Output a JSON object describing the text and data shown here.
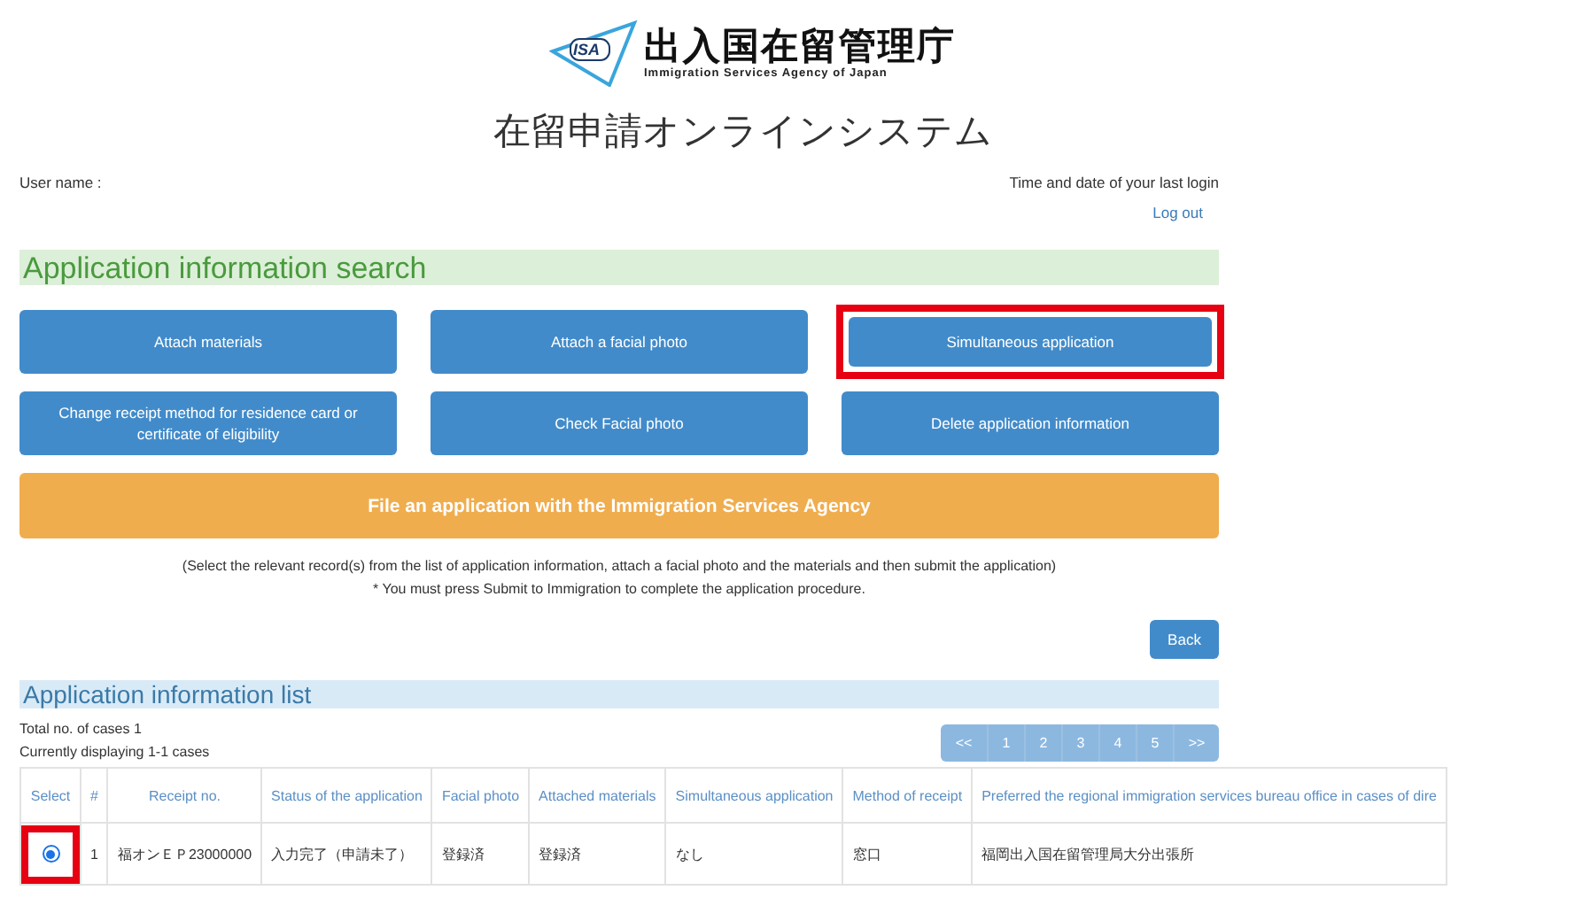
{
  "header": {
    "logo_mark": "ISA",
    "agency_name": "出入国在留管理庁",
    "agency_name_en": "Immigration Services Agency of Japan",
    "system_title": "在留申請オンラインシステム"
  },
  "user_bar": {
    "user_label": "User name :",
    "last_login_label": "Time and date of your last login",
    "logout": "Log out"
  },
  "search_section": {
    "title": "Application information search",
    "buttons": [
      {
        "label": "Attach materials",
        "highlighted": false
      },
      {
        "label": "Attach a facial photo",
        "highlighted": false
      },
      {
        "label": "Simultaneous application",
        "highlighted": true
      },
      {
        "label": "Change receipt method for residence card or certificate of eligibility",
        "highlighted": false
      },
      {
        "label": "Check Facial photo",
        "highlighted": false
      },
      {
        "label": "Delete application information",
        "highlighted": false
      }
    ],
    "file_button": "File an application with the Immigration Services Agency",
    "notes": [
      "(Select the relevant record(s) from the list of application information, attach a facial photo and the materials and then submit the application)",
      "* You must press Submit to Immigration to complete the application procedure."
    ],
    "back_button": "Back"
  },
  "list_section": {
    "title": "Application information list",
    "total": "Total no. of cases 1",
    "displaying": "Currently displaying 1-1 cases",
    "pagination": [
      {
        "label": "<<",
        "selected": false
      },
      {
        "label": "1",
        "selected": false
      },
      {
        "label": "2",
        "selected": false
      },
      {
        "label": "3",
        "selected": false
      },
      {
        "label": "4",
        "selected": false
      },
      {
        "label": "5",
        "selected": false
      },
      {
        "label": ">>",
        "selected": false
      }
    ],
    "columns": [
      "Select",
      "#",
      "Receipt no.",
      "Status of the application",
      "Facial photo",
      "Attached materials",
      "Simultaneous application",
      "Method of receipt",
      "Preferred the regional immigration services bureau office in cases of dire"
    ],
    "rows": [
      {
        "selected": true,
        "highlighted": true,
        "cells": [
          "",
          "1",
          "福オンＥＰ23000000",
          "入力完了（申請未了）",
          "登録済",
          "登録済",
          "なし",
          "窓口",
          "福岡出入国在留管理局大分出張所"
        ]
      }
    ]
  }
}
